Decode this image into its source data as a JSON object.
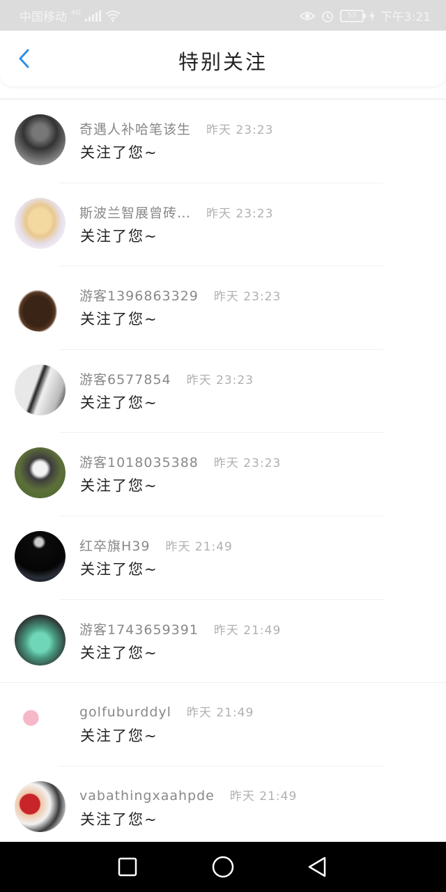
{
  "status_bar": {
    "carrier": "中国移动",
    "network": "4G",
    "battery": "53",
    "time": "下午3:21"
  },
  "header": {
    "title": "特别关注"
  },
  "items": [
    {
      "name": "奇遇人补哈笔该生",
      "time": "昨天 23:23",
      "message": "关注了您~"
    },
    {
      "name": "斯波兰智展曾砖…",
      "time": "昨天 23:23",
      "message": "关注了您~"
    },
    {
      "name": "游客1396863329",
      "time": "昨天 23:23",
      "message": "关注了您~"
    },
    {
      "name": "游客6577854",
      "time": "昨天 23:23",
      "message": "关注了您~"
    },
    {
      "name": "游客1018035388",
      "time": "昨天 23:23",
      "message": "关注了您~"
    },
    {
      "name": "红卒旗H39",
      "time": "昨天 21:49",
      "message": "关注了您~"
    },
    {
      "name": "游客1743659391",
      "time": "昨天 21:49",
      "message": "关注了您~"
    },
    {
      "name": "golfuburddyl",
      "time": "昨天 21:49",
      "message": "关注了您~"
    },
    {
      "name": "vabathingxaahpde",
      "time": "昨天 21:49",
      "message": "关注了您~"
    }
  ],
  "colors": {
    "accent": "#2b8fe8",
    "status_bar": "#dcdcdc",
    "nav_bar": "#000000"
  },
  "icons": {
    "back": "chevron-left-icon",
    "nav_recent": "square-icon",
    "nav_home": "circle-icon",
    "nav_back": "triangle-back-icon"
  }
}
